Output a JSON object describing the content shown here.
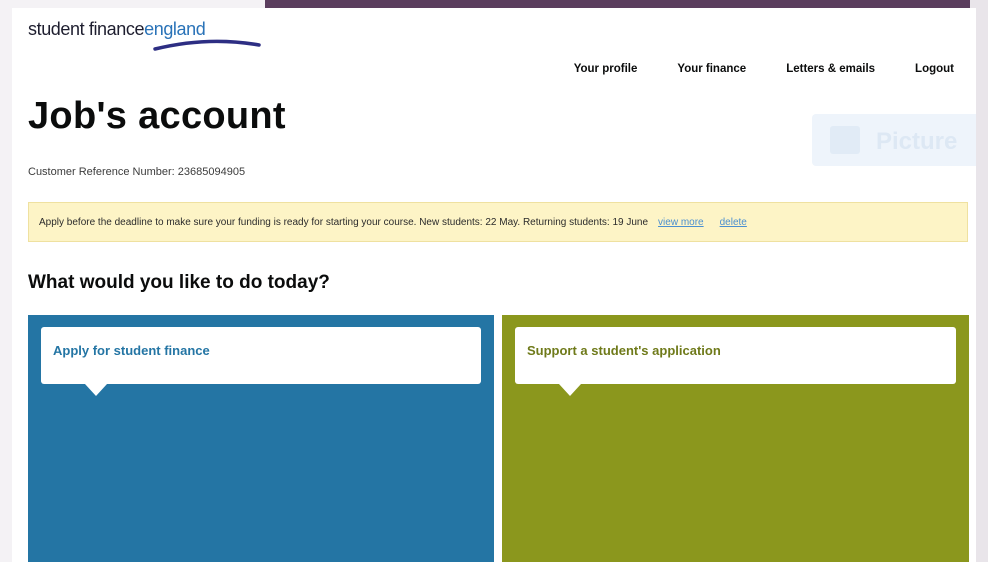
{
  "brand": {
    "part1": "student finance",
    "part2": "england"
  },
  "nav": {
    "profile": "Your profile",
    "finance": "Your finance",
    "letters": "Letters & emails",
    "logout": "Logout"
  },
  "page": {
    "title": "Job's account",
    "customer_ref": "Customer Reference Number: 23685094905"
  },
  "banner": {
    "message": "Apply before the deadline to make sure your funding is ready for starting your course. New students: 22 May. Returning students: 19 June",
    "view_more": "view more",
    "delete": "delete"
  },
  "section": {
    "heading": "What would you like to do today?"
  },
  "tiles": [
    {
      "label": "Apply for student finance",
      "color": "#2475a4"
    },
    {
      "label": "Support a student's application",
      "color": "#8b971d"
    }
  ],
  "colors": {
    "frame_accent": "#5b3e5e",
    "brand_blue": "#2a73b8",
    "banner_bg": "#fdf4c6"
  }
}
